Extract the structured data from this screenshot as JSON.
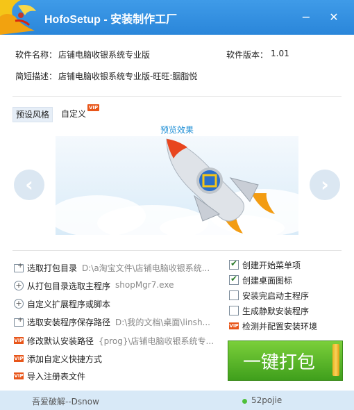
{
  "window": {
    "title": "HofoSetup - 安装制作工厂",
    "minimize": "−",
    "close": "✕"
  },
  "info": {
    "name_label": "软件名称：",
    "name_value": "店铺电脑收银系统专业版",
    "version_label": "软件版本：",
    "version_value": "1.01",
    "desc_label": "简短描述：",
    "desc_value": "店铺电脑收银系统专业版-旺旺:胭脂悦"
  },
  "tabs": {
    "preset": "预设风格",
    "custom": "自定义",
    "vip": "VIP"
  },
  "preview": {
    "label": "预览效果",
    "prev_icon": "‹",
    "next_icon": "›"
  },
  "options": [
    {
      "label": "选取打包目录",
      "path": "D:\\a淘宝文件\\店铺电脑收银系统...",
      "icon": "folder-open-icon"
    },
    {
      "label": "从打包目录选取主程序",
      "path": "shopMgr7.exe",
      "icon": "plus-circle-icon"
    },
    {
      "label": "自定义扩展程序或脚本",
      "path": "",
      "icon": "plus-circle-icon"
    },
    {
      "label": "选取安装程序保存路径",
      "path": "D:\\我的文档\\桌面\\linsh...",
      "icon": "folder-open-icon"
    },
    {
      "label": "修改默认安装路径",
      "path": "{prog}\\店铺电脑收银系统专...",
      "icon": "vip-icon"
    },
    {
      "label": "添加自定义快捷方式",
      "path": "",
      "icon": "vip-icon"
    },
    {
      "label": "导入注册表文件",
      "path": "",
      "icon": "vip-icon"
    }
  ],
  "checkboxes": [
    {
      "label": "创建开始菜单项",
      "checked": true
    },
    {
      "label": "创建桌面图标",
      "checked": true
    },
    {
      "label": "安装完启动主程序",
      "checked": false
    },
    {
      "label": "生成静默安装程序",
      "checked": false
    },
    {
      "label": "检测并配置安装环境",
      "checked": false,
      "vip": true
    }
  ],
  "pack_button": {
    "label": "一键打包"
  },
  "status": {
    "left": "吾爱破解--Dsnow",
    "right": "52pojie"
  },
  "colors": {
    "titlebar": "#2a86da",
    "accent": "#1f8fd6",
    "pack_green": "#5cb82a",
    "vip": "#e8561a"
  }
}
